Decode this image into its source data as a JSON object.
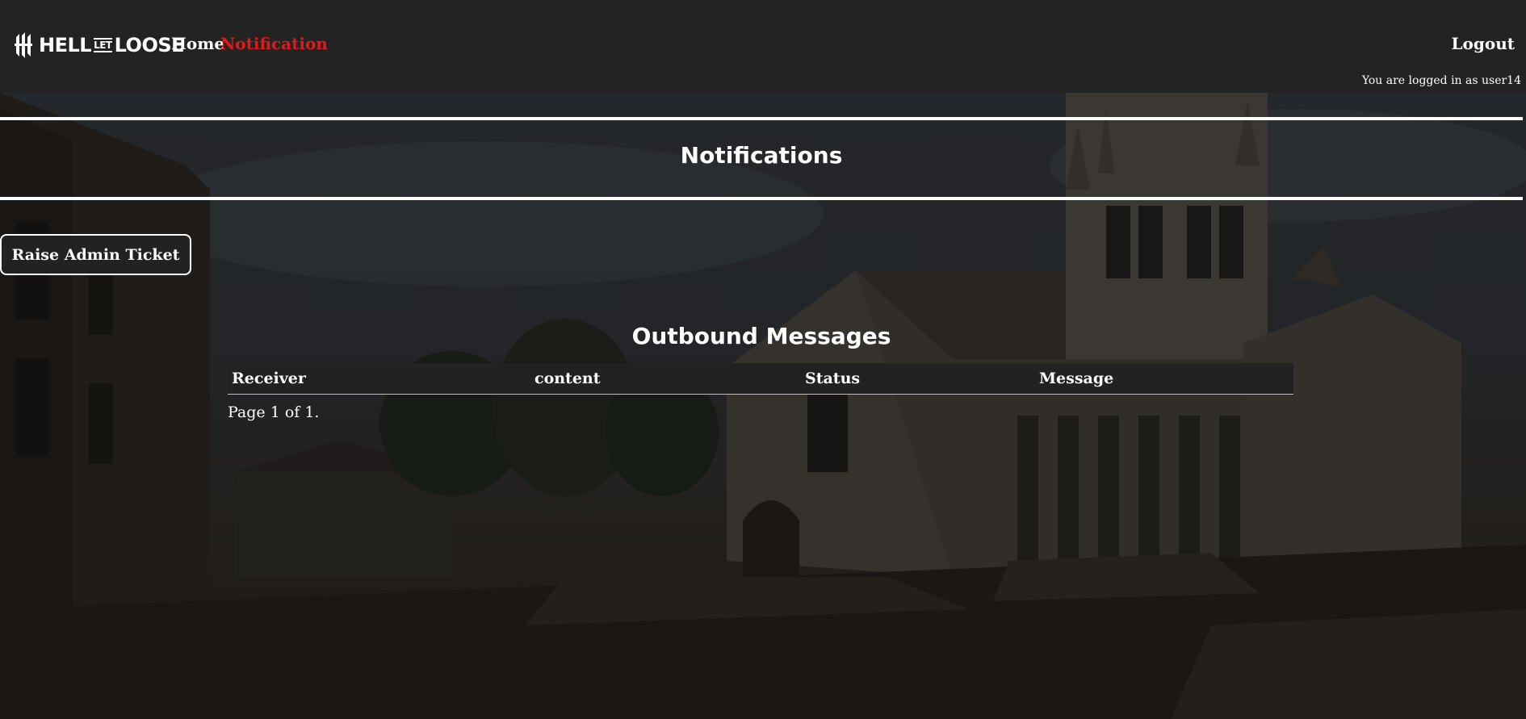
{
  "brand": {
    "logo_text_left": "HELL",
    "logo_text_mid": "LET",
    "logo_text_right": "LOOSE"
  },
  "nav": {
    "home": "Home",
    "notification": "Notification",
    "logout": "Logout",
    "login_info": "You are logged in as user14",
    "active_color": "#e01a1a"
  },
  "main": {
    "title": "Notifications",
    "ticket_button": "Raise Admin Ticket",
    "outbound_title": "Outbound Messages",
    "table": {
      "columns": [
        "Receiver",
        "content",
        "Status",
        "Message"
      ],
      "rows": []
    },
    "pager": "Page 1 of 1."
  }
}
